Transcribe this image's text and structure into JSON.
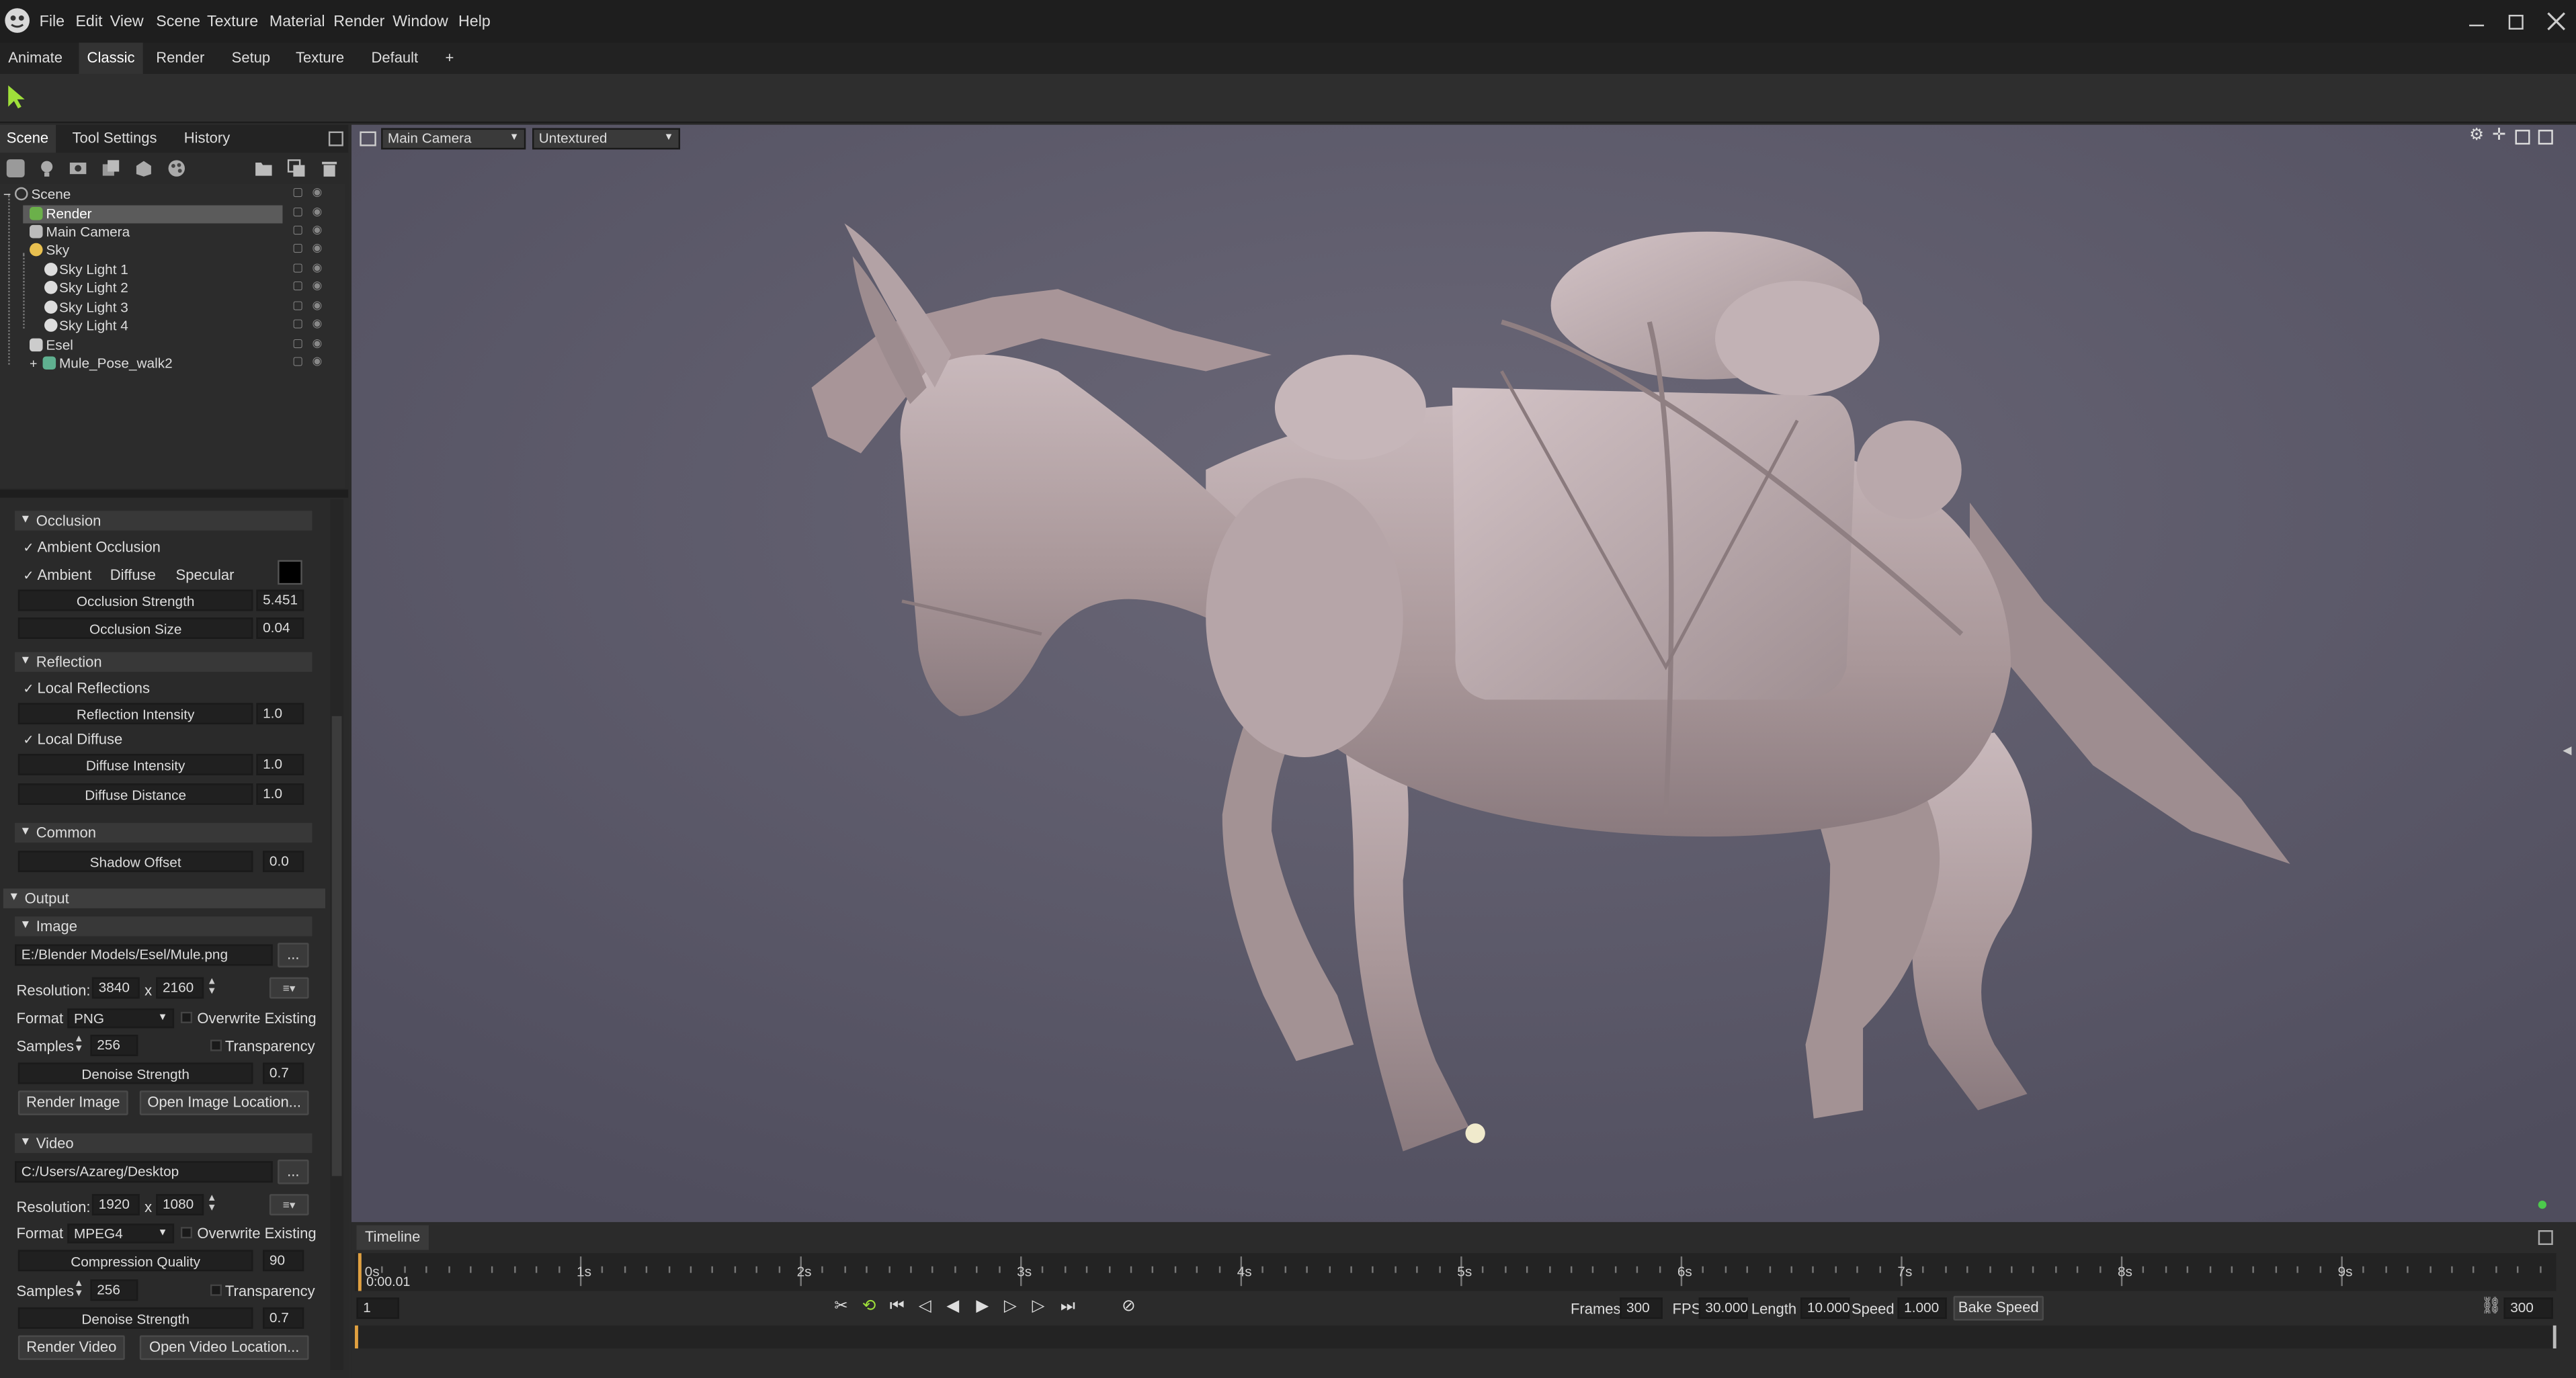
{
  "menu": [
    "File",
    "Edit",
    "View",
    "Scene",
    "Texture",
    "Material",
    "Render",
    "Window",
    "Help"
  ],
  "workspace_tabs": [
    "Animate",
    "Classic",
    "Render",
    "Setup",
    "Texture",
    "Default",
    "+"
  ],
  "panel_tabs": [
    "Scene",
    "Tool Settings",
    "History"
  ],
  "scene_tree": [
    {
      "label": "Scene",
      "indent": 0
    },
    {
      "label": "Render",
      "indent": 1
    },
    {
      "label": "Main Camera",
      "indent": 1
    },
    {
      "label": "Sky",
      "indent": 1
    },
    {
      "label": "Sky Light 1",
      "indent": 2
    },
    {
      "label": "Sky Light 2",
      "indent": 2
    },
    {
      "label": "Sky Light 3",
      "indent": 2
    },
    {
      "label": "Sky Light 4",
      "indent": 2
    },
    {
      "label": "Esel",
      "indent": 1
    },
    {
      "label": "Mule_Pose_walk2",
      "indent": 2
    }
  ],
  "occlusion": {
    "title": "Occlusion",
    "ambient_occlusion": "Ambient Occlusion",
    "ambient": "Ambient",
    "diffuse": "Diffuse",
    "specular": "Specular",
    "strength_label": "Occlusion Strength",
    "strength_value": "5.451",
    "size_label": "Occlusion Size",
    "size_value": "0.04"
  },
  "reflection": {
    "title": "Reflection",
    "local_reflections": "Local Reflections",
    "intensity_label": "Reflection Intensity",
    "intensity_value": "1.0",
    "local_diffuse": "Local Diffuse",
    "diffuse_intensity_label": "Diffuse Intensity",
    "diffuse_intensity_value": "1.0",
    "diffuse_distance_label": "Diffuse Distance",
    "diffuse_distance_value": "1.0"
  },
  "common": {
    "title": "Common",
    "shadow_offset_label": "Shadow Offset",
    "shadow_offset_value": "0.0"
  },
  "output": {
    "title": "Output",
    "image": {
      "title": "Image",
      "path": "E:/Blender Models/Esel/Mule.png",
      "browse": "...",
      "resolution_label": "Resolution:",
      "res_w": "3840",
      "x": "x",
      "res_h": "2160",
      "format_label": "Format",
      "format": "PNG",
      "overwrite": "Overwrite Existing",
      "samples_label": "Samples",
      "samples": "256",
      "transparency": "Transparency",
      "denoise_label": "Denoise Strength",
      "denoise_value": "0.7",
      "render_btn": "Render Image",
      "open_btn": "Open Image Location..."
    },
    "video": {
      "title": "Video",
      "path": "C:/Users/Azareg/Desktop",
      "browse": "...",
      "resolution_label": "Resolution:",
      "res_w": "1920",
      "x": "x",
      "res_h": "1080",
      "format_label": "Format",
      "format": "MPEG4",
      "overwrite": "Overwrite Existing",
      "compression_label": "Compression Quality",
      "compression_value": "90",
      "samples_label": "Samples",
      "samples": "256",
      "transparency": "Transparency",
      "denoise_label": "Denoise Strength",
      "denoise_value": "0.7",
      "render_btn": "Render Video",
      "open_btn": "Open Video Location..."
    }
  },
  "viewport": {
    "camera": "Main Camera",
    "shading": "Untextured"
  },
  "timeline": {
    "tab": "Timeline",
    "time": "0:00.01",
    "ticks": [
      "0s",
      "1s",
      "2s",
      "3s",
      "4s",
      "5s",
      "6s",
      "7s",
      "8s",
      "9s"
    ],
    "frame_field": "1",
    "frames_label": "Frames",
    "frames": "300",
    "fps_label": "FPS",
    "fps": "30.000",
    "length_label": "Length",
    "length": "10.000",
    "speed_label": "Speed",
    "speed": "1.000",
    "bake_btn": "Bake Speed",
    "end_frame": "300"
  },
  "colors": {
    "accent_green": "#9fe03a",
    "viewport_bg": "#5c5a6b",
    "model": "#b9a9ab",
    "selection": "#5b5b5b",
    "playhead": "#e0a040"
  }
}
